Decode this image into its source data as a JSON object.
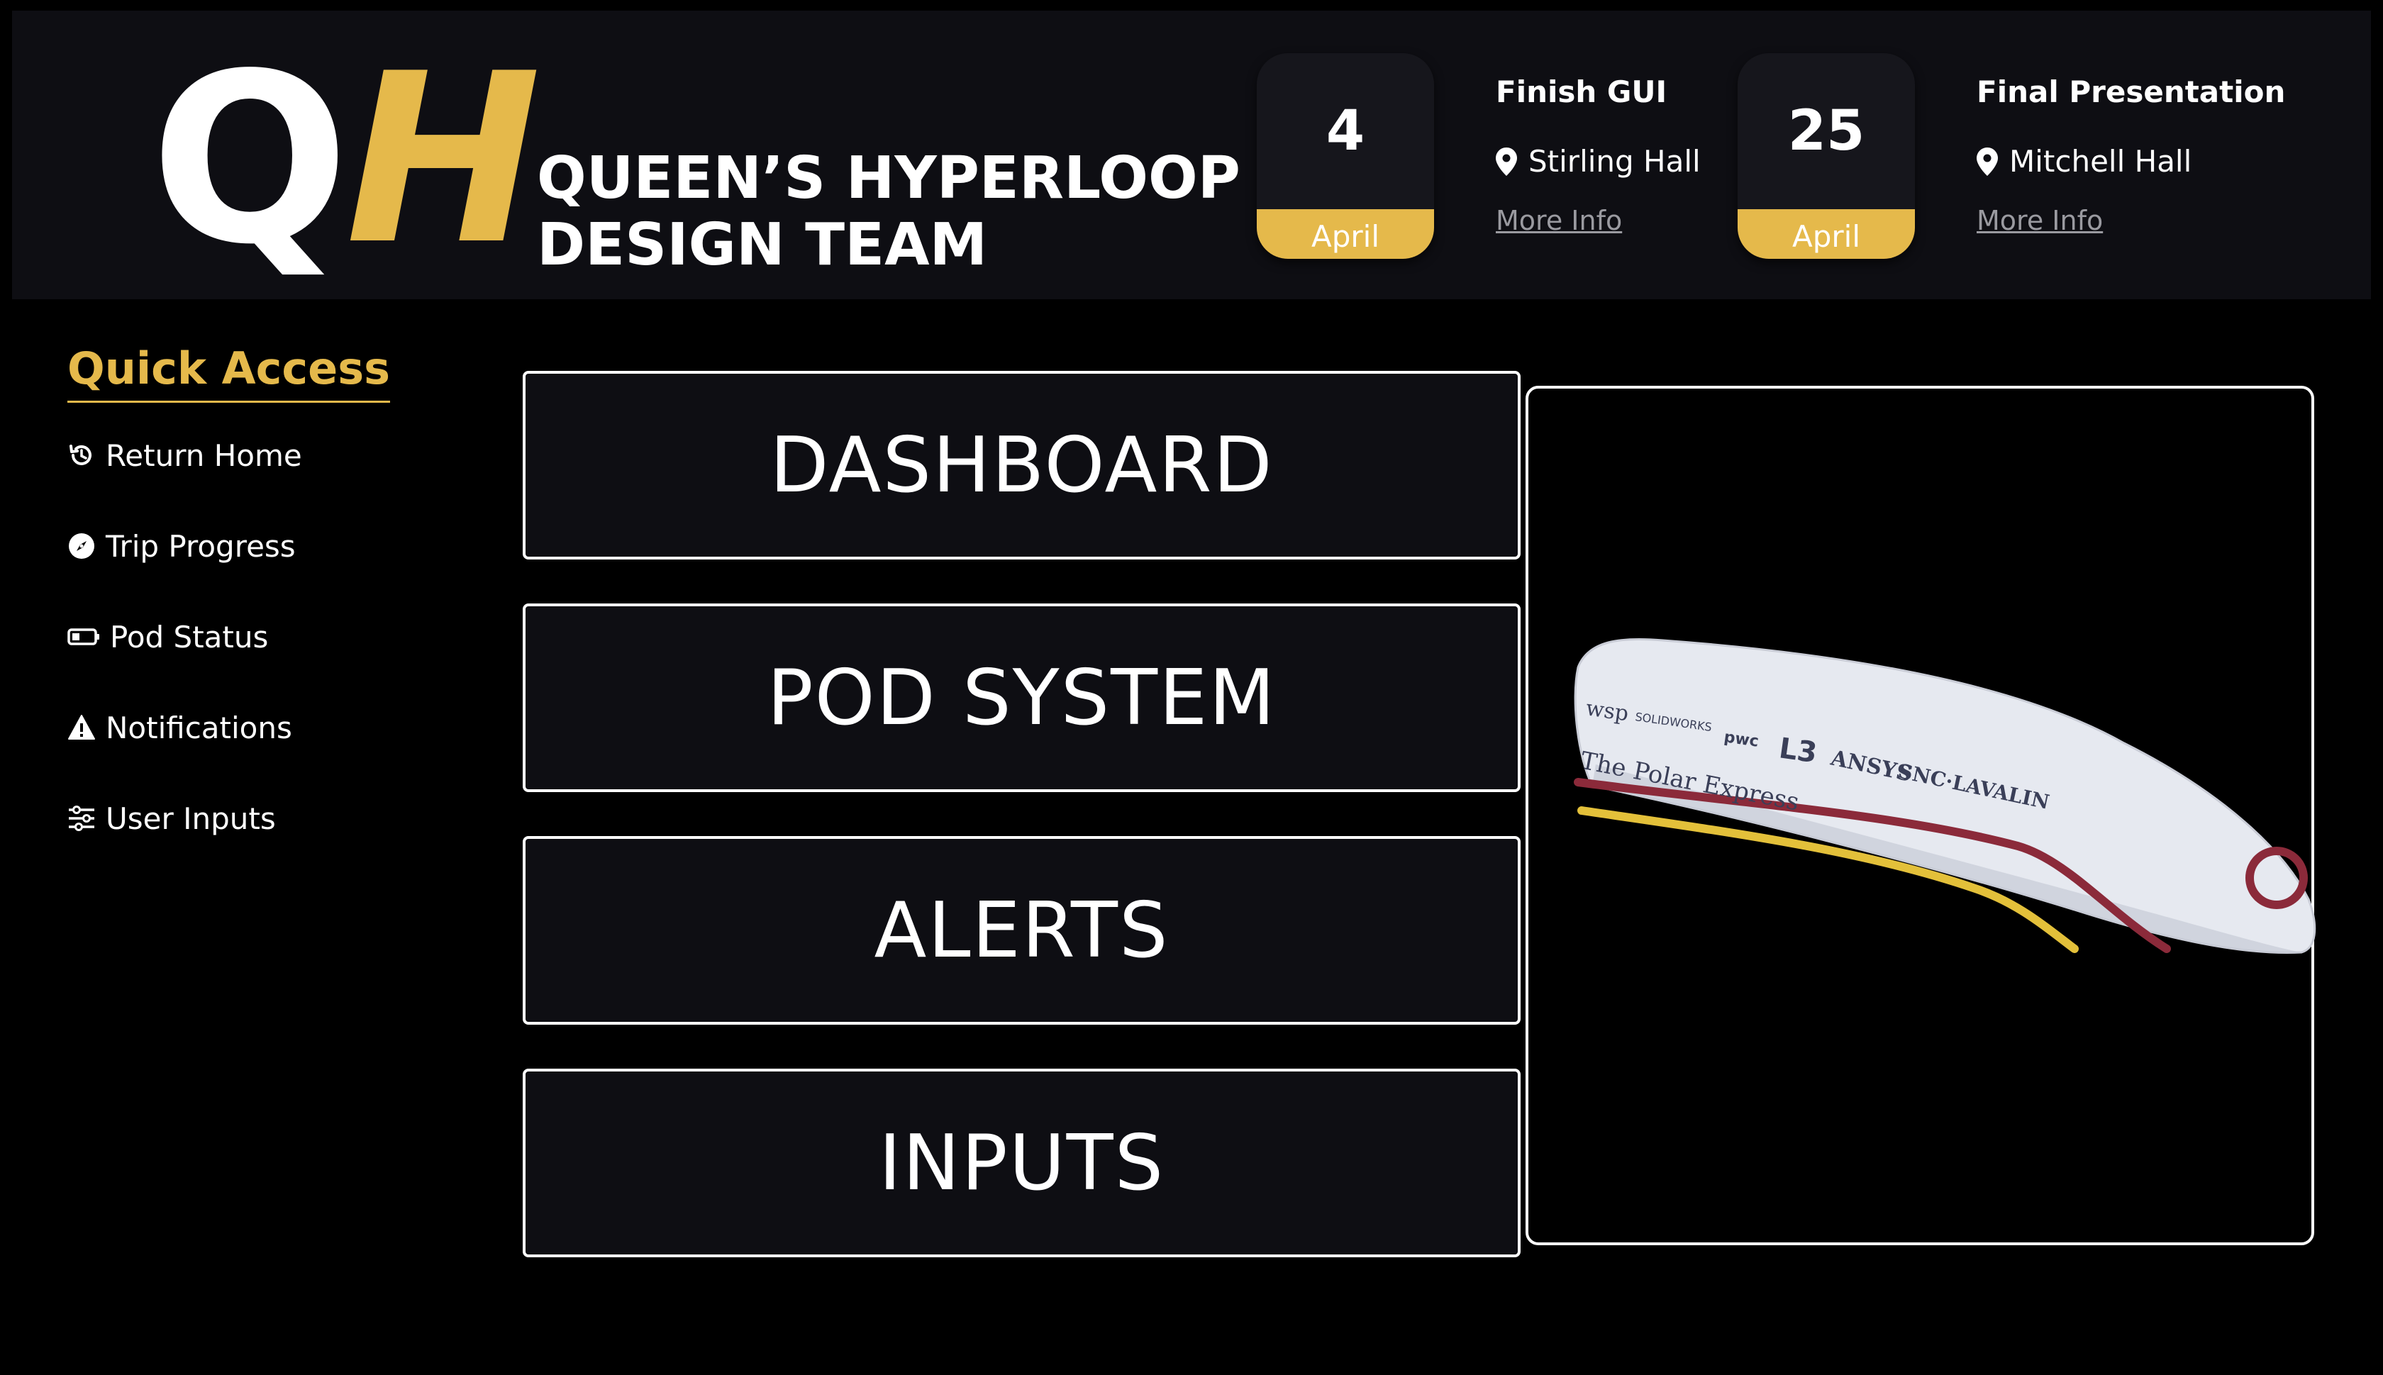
{
  "header": {
    "logo": {
      "mark_q": "Q",
      "mark_h": "H",
      "line1": "QUEEN’S HYPERLOOP",
      "line2": "DESIGN TEAM"
    },
    "events": [
      {
        "day": "4",
        "month": "April",
        "title": "Finish GUI",
        "location": "Stirling Hall",
        "more_label": "More Info"
      },
      {
        "day": "25",
        "month": "April",
        "title": "Final Presentation",
        "location": "Mitchell Hall",
        "more_label": "More Info"
      }
    ]
  },
  "sidebar": {
    "title": "Quick Access",
    "items": [
      {
        "label": "Return Home",
        "icon": "history-icon"
      },
      {
        "label": "Trip Progress",
        "icon": "compass-icon"
      },
      {
        "label": "Pod Status",
        "icon": "battery-icon"
      },
      {
        "label": "Notifications",
        "icon": "warning-icon"
      },
      {
        "label": "User Inputs",
        "icon": "sliders-icon"
      }
    ]
  },
  "main": {
    "buttons": [
      "DASHBOARD",
      "POD SYSTEM",
      "ALERTS",
      "INPUTS"
    ]
  },
  "pod": {
    "livery_text": "The Polar Express",
    "sponsors": [
      "wsp",
      "SOLIDWORKS",
      "pwc",
      "L3",
      "ANSYS",
      "SNC·LAVALIN"
    ]
  },
  "colors": {
    "accent": "#e5b94b",
    "header_bg": "#0e0e13",
    "page_bg": "#000000",
    "stripe_maroon": "#8b2a3a",
    "stripe_yellow": "#e3c03a"
  }
}
